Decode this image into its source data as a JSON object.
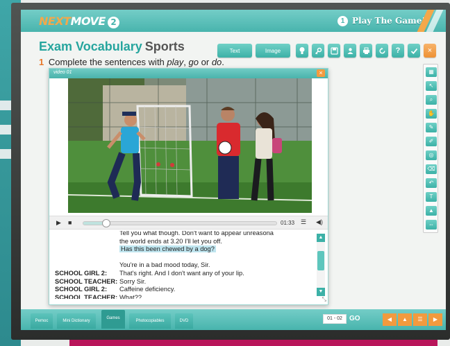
{
  "header": {
    "brand_next": "NEXT",
    "brand_move": "MOVE",
    "brand_level": "2",
    "play_number": "1",
    "play_label": "Play The Game!"
  },
  "page": {
    "title": "Exam Vocabulary",
    "subtitle": "Sports",
    "instruction_number": "1",
    "instruction_pre": "Complete the sentences with",
    "word1": "play",
    "word2": "go",
    "word3": "do",
    "sep1": ",",
    "sep2": "or",
    "end": "."
  },
  "toolbar": {
    "text_label": "Text",
    "image_label": "Image",
    "icons": [
      "lightbulb-icon",
      "key-icon",
      "save-icon",
      "character-icon",
      "print-icon",
      "reset-icon",
      "help-icon",
      "check-icon",
      "close-icon"
    ]
  },
  "video": {
    "window_title": "video 01",
    "close": "×",
    "timecode": "01:33",
    "progress": 0.12
  },
  "transcript": [
    {
      "speaker": "",
      "line": "Tell you what though. Don't want to appear unreasona",
      "highlight": false
    },
    {
      "speaker": "",
      "line": "the world ends at 3.20 I'll let you off.",
      "highlight": false
    },
    {
      "speaker": "",
      "line": "Has this been chewed by a dog?",
      "highlight": true
    },
    {
      "speaker": "",
      "line": "",
      "highlight": false
    },
    {
      "speaker": "",
      "line": "You're in a bad mood today, Sir.",
      "highlight": false
    },
    {
      "speaker": "SCHOOL GIRL 2:",
      "line": "That's right. And I don't want any of your lip.",
      "highlight": false
    },
    {
      "speaker": "SCHOOL TEACHER:",
      "line": "Sorry Sir.",
      "highlight": false
    },
    {
      "speaker": "SCHOOL GIRL 2:",
      "line": "Caffeine deficiency.",
      "highlight": false
    },
    {
      "speaker": "SCHOOL TEACHER:",
      "line": "What??",
      "highlight": false
    }
  ],
  "right_tools": [
    "pattern-icon",
    "cursor-icon",
    "zoom-icon",
    "hand-icon",
    "pen-icon",
    "highlighter-icon",
    "spotlight-icon",
    "eraser-icon",
    "undo-icon",
    "text-tool-icon",
    "paint-icon",
    "expand-icon"
  ],
  "bottom": {
    "tabs": [
      "Pemoc",
      "Mini Dictionary",
      "Games",
      "Photocopiables",
      "DVD"
    ],
    "active_tab": "Games",
    "page_range": "01 - 02",
    "go_label": "GO",
    "nav_icons": [
      "prev-icon",
      "up-icon",
      "menu-icon",
      "next-icon"
    ]
  },
  "colors": {
    "teal": "#48b4ad",
    "teal_dark": "#26a59e",
    "orange": "#f39b3f",
    "highlight": "#bfe5ef"
  }
}
